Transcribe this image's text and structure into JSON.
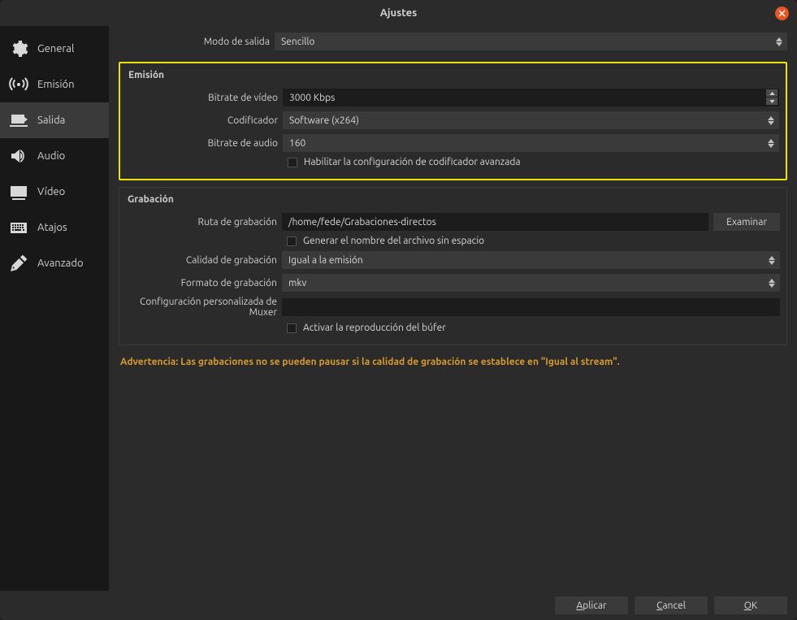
{
  "window": {
    "title": "Ajustes"
  },
  "sidebar": {
    "items": [
      {
        "label": "General",
        "icon": "gear"
      },
      {
        "label": "Emisión",
        "icon": "stream"
      },
      {
        "label": "Salida",
        "icon": "output"
      },
      {
        "label": "Audio",
        "icon": "audio"
      },
      {
        "label": "Vídeo",
        "icon": "video"
      },
      {
        "label": "Atajos",
        "icon": "keyboard"
      },
      {
        "label": "Avanzado",
        "icon": "advanced"
      }
    ],
    "active_index": 2
  },
  "output_mode": {
    "label": "Modo de salida",
    "value": "Sencillo"
  },
  "streaming": {
    "title": "Emisión",
    "video_bitrate_label": "Bitrate de vídeo",
    "video_bitrate_value": "3000 Kbps",
    "encoder_label": "Codificador",
    "encoder_value": "Software (x264)",
    "audio_bitrate_label": "Bitrate de audio",
    "audio_bitrate_value": "160",
    "advanced_encoder_label": "Habilitar la configuración de codificador avanzada",
    "advanced_encoder_checked": false
  },
  "recording": {
    "title": "Grabación",
    "path_label": "Ruta de grabación",
    "path_value": "/home/fede/Grabaciones-directos",
    "browse_label": "Examinar",
    "no_space_label": "Generar el nombre del archivo sin espacio",
    "no_space_checked": false,
    "quality_label": "Calidad de grabación",
    "quality_value": "Igual a la emisión",
    "format_label": "Formato de grabación",
    "format_value": "mkv",
    "muxer_label": "Configuración personalizada de Muxer",
    "muxer_value": "",
    "replay_buffer_label": "Activar la reproducción del búfer",
    "replay_buffer_checked": false
  },
  "warning": "Advertencia: Las grabaciones no se pueden pausar si la calidad de grabación se establece en \"Igual al stream\".",
  "footer": {
    "apply": "Aplicar",
    "cancel": "Cancel",
    "ok": "OK"
  }
}
